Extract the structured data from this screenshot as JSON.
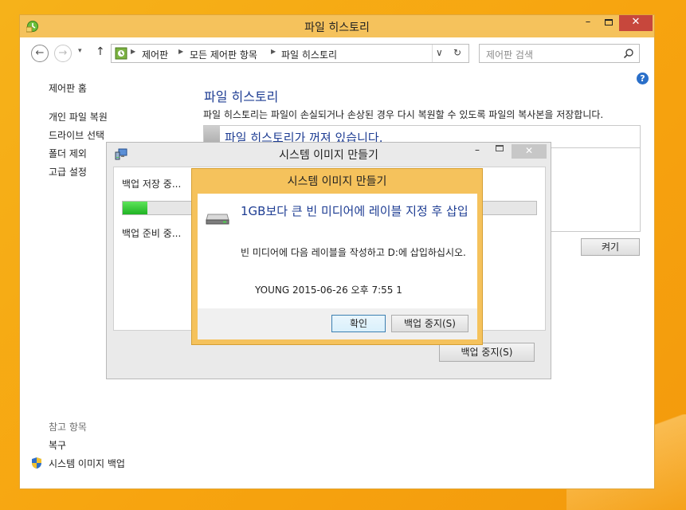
{
  "window": {
    "title": "파일 히스토리",
    "controls": {
      "minimize": "–",
      "close": "✕"
    }
  },
  "nav": {
    "back_glyph": "←",
    "forward_glyph": "→",
    "recent_glyph": "▾",
    "up_glyph": "↑",
    "breadcrumbs": [
      "제어판",
      "모든 제어판 항목",
      "파일 히스토리"
    ],
    "dropdown_glyph": "∨",
    "refresh_glyph": "↻",
    "search_placeholder": "제어판 검색"
  },
  "sidebar": {
    "home": "제어판 홈",
    "items": [
      "개인 파일 복원",
      "드라이브 선택",
      "폴더 제외",
      "고급 설정"
    ],
    "see_also": "참고 항목",
    "links": [
      "복구",
      "시스템 이미지 백업"
    ]
  },
  "main": {
    "help_glyph": "?",
    "heading": "파일 히스토리",
    "description": "파일 히스토리는 파일이 손실되거나 손상된 경우 다시 복원할 수 있도록 파일의 복사본을 저장합니다.",
    "status": "파일 히스토리가 꺼져 있습니다.",
    "turn_on": "켜기"
  },
  "system_image_dialog": {
    "title": "시스템 이미지 만들기",
    "status_line1": "백업 저장 중...",
    "status_line2": "백업 준비 중...",
    "progress": 0.06,
    "stop_button": "백업 중지(S)",
    "controls": {
      "minimize": "–",
      "close": "✕"
    }
  },
  "message_box": {
    "title": "시스템 이미지 만들기",
    "heading": "1GB보다 큰 빈 미디어에 레이블 지정 후 삽입",
    "text": "빈 미디어에 다음 레이블을 작성하고 D:에 삽입하십시오.",
    "label": "YOUNG 2015-06-26 오후 7:55   1",
    "ok_button": "확인",
    "stop_button": "백업 중지(S)"
  },
  "colors": {
    "titlebar": "#f5c25c",
    "link_blue": "#1e3d93",
    "close_red": "#c7473c",
    "progress_green": "#20b324"
  }
}
